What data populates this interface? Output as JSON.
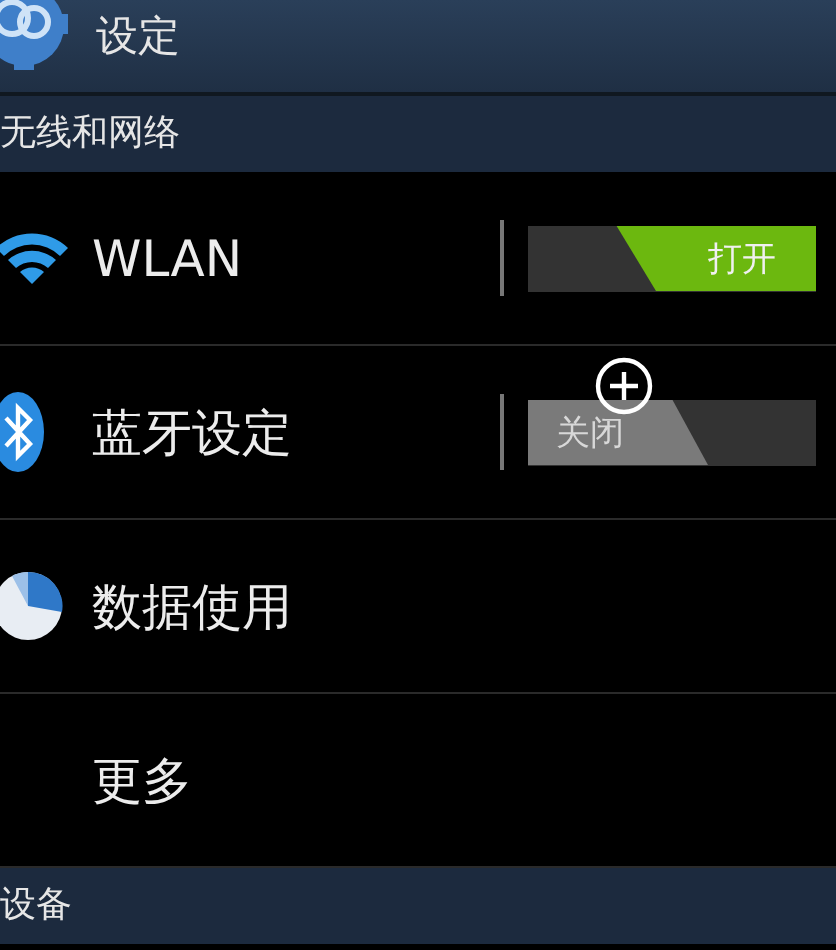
{
  "title_bar": {
    "title": "设定"
  },
  "sections": [
    {
      "header": "无线和网络",
      "rows": [
        {
          "kind": "toggle",
          "label": "WLAN",
          "switch": {
            "on": true,
            "label": "打开"
          }
        },
        {
          "kind": "toggle",
          "label": "蓝牙设定",
          "switch": {
            "on": false,
            "label": "关闭"
          }
        },
        {
          "kind": "plain",
          "label": "数据使用"
        },
        {
          "kind": "plain",
          "label": "更多"
        }
      ]
    },
    {
      "header": "设备"
    }
  ]
}
